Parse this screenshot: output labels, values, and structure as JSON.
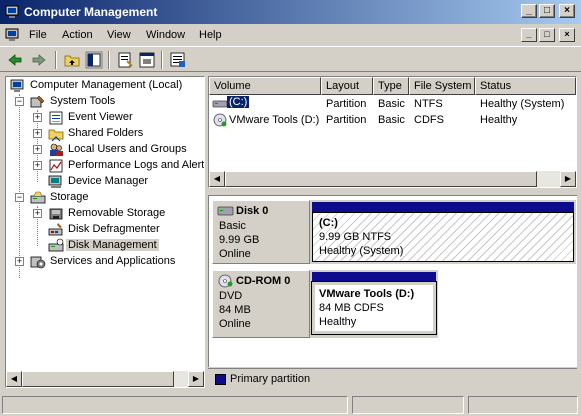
{
  "window": {
    "title": "Computer Management"
  },
  "menu": {
    "items": [
      "File",
      "Action",
      "View",
      "Window",
      "Help"
    ]
  },
  "caption_buttons": {
    "minimize": "_",
    "maximize": "□",
    "close": "×"
  },
  "toolbar": {
    "icons": [
      "back-arrow-icon",
      "forward-arrow-icon",
      "up-folder-icon",
      "show-hide-tree-icon",
      "properties-icon",
      "help-icon",
      "export-list-icon"
    ]
  },
  "tree": {
    "root": "Computer Management (Local)",
    "system_tools": "System Tools",
    "event_viewer": "Event Viewer",
    "shared_folders": "Shared Folders",
    "local_users": "Local Users and Groups",
    "perf_logs": "Performance Logs and Alerts",
    "device_manager": "Device Manager",
    "storage": "Storage",
    "removable_storage": "Removable Storage",
    "disk_defragmenter": "Disk Defragmenter",
    "disk_management": "Disk Management",
    "services_apps": "Services and Applications",
    "expander_plus": "+",
    "expander_minus": "−"
  },
  "volume_list": {
    "columns": [
      "Volume",
      "Layout",
      "Type",
      "File System",
      "Status"
    ],
    "rows": [
      {
        "volume": "(C:)",
        "layout": "Partition",
        "type": "Basic",
        "fs": "NTFS",
        "status": "Healthy (System)"
      },
      {
        "volume": "VMware Tools (D:)",
        "layout": "Partition",
        "type": "Basic",
        "fs": "CDFS",
        "status": "Healthy"
      }
    ]
  },
  "disks": [
    {
      "name": "Disk 0",
      "kind": "Basic",
      "size": "9.99 GB",
      "state": "Online",
      "partition": {
        "label": "(C:)",
        "detail": "9.99 GB NTFS",
        "status": "Healthy (System)"
      }
    },
    {
      "name": "CD-ROM 0",
      "kind": "DVD",
      "size": "84 MB",
      "state": "Online",
      "partition": {
        "label": "VMware Tools  (D:)",
        "detail": "84 MB CDFS",
        "status": "Healthy"
      }
    }
  ],
  "legend": {
    "label": "Primary partition",
    "color": "#0c0c8c"
  },
  "scroll_arrows": {
    "left": "◀",
    "right": "▶"
  }
}
